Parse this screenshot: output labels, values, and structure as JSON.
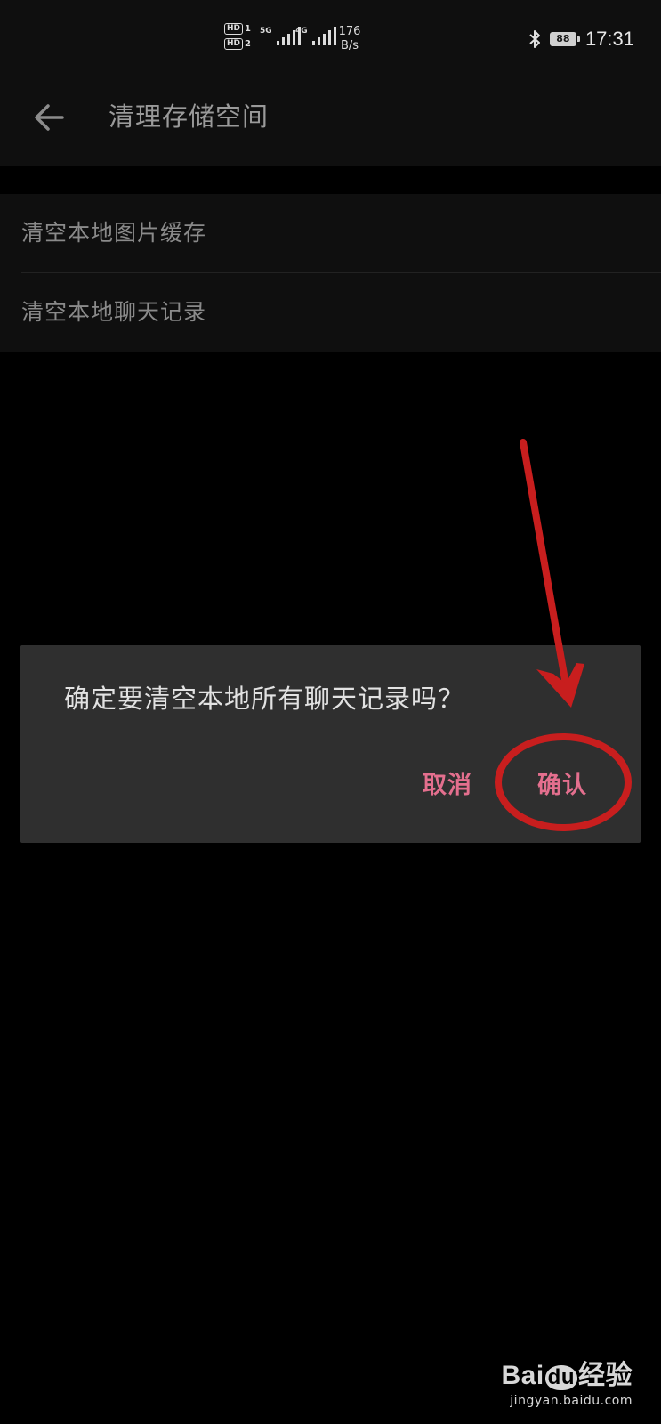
{
  "status_bar": {
    "sim1_label": "HD",
    "sim1_index": "1",
    "sim2_label": "HD",
    "sim2_index": "2",
    "network1_label": "5G",
    "network2_label": "4G",
    "speed_value": "176",
    "speed_unit": "B/s",
    "bluetooth_icon": "bluetooth-icon",
    "battery_level": "88",
    "time": "17:31"
  },
  "app_bar": {
    "back_icon": "arrow-left-icon",
    "title": "清理存储空间"
  },
  "list": {
    "items": [
      {
        "label": "清空本地图片缓存"
      },
      {
        "label": "清空本地聊天记录"
      }
    ]
  },
  "dialog": {
    "message": "确定要清空本地所有聊天记录吗？",
    "cancel_label": "取消",
    "confirm_label": "确认",
    "button_color": "#e46f8e"
  },
  "annotation": {
    "color": "#c81e1e",
    "shapes": [
      "arrow",
      "ellipse"
    ]
  },
  "watermark": {
    "logo_part1": "Bai",
    "logo_part2": "du",
    "logo_part3": "经验",
    "url": "jingyan.baidu.com"
  }
}
